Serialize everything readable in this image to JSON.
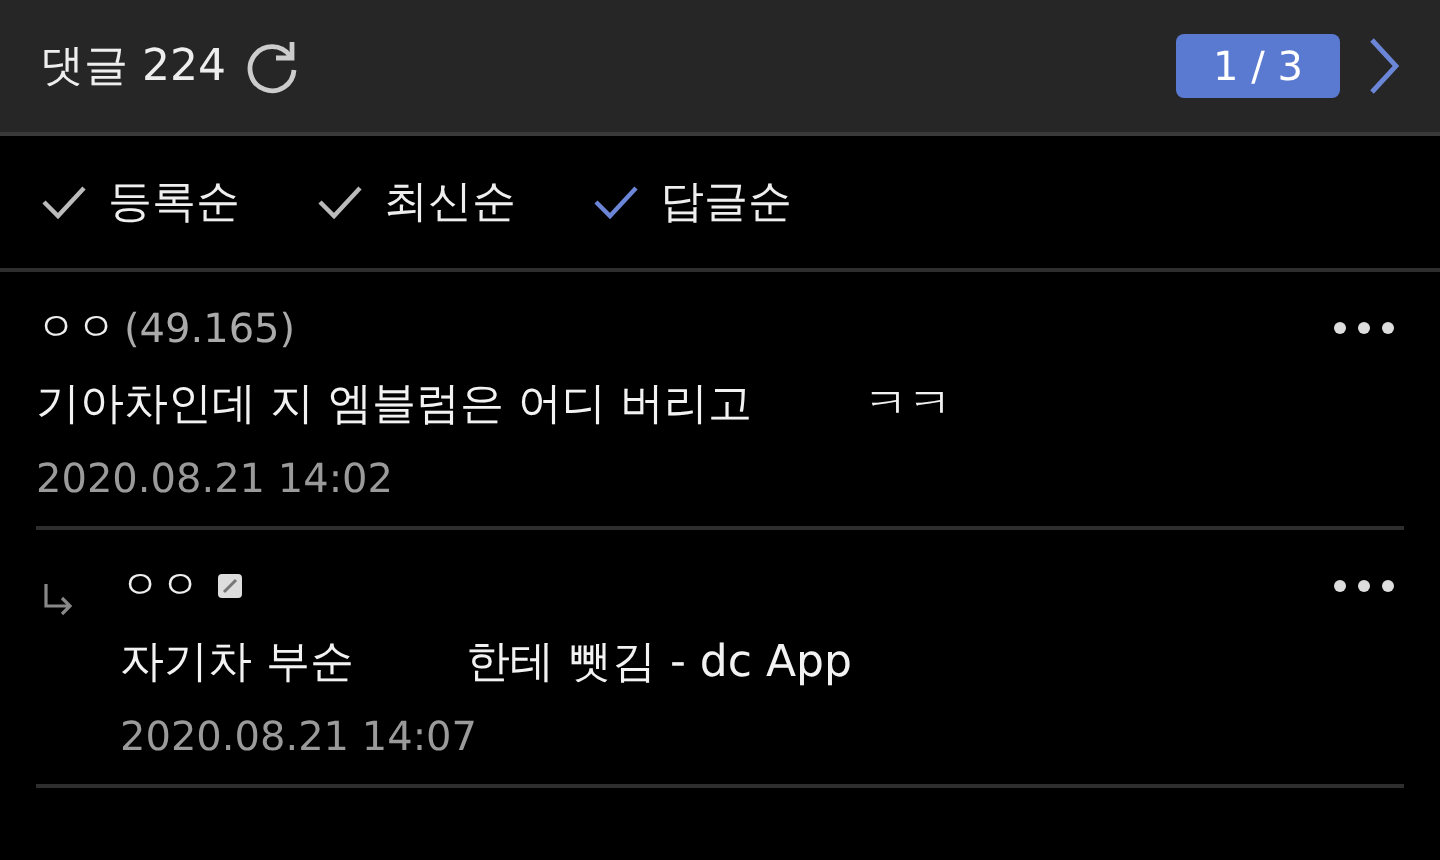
{
  "header": {
    "title": "댓글 224",
    "pager": "1 / 3"
  },
  "sort_options": [
    {
      "label": "등록순",
      "selected": false
    },
    {
      "label": "최신순",
      "selected": false
    },
    {
      "label": "답글순",
      "selected": true
    }
  ],
  "comments": [
    {
      "kind": "comment",
      "author": "ㅇㅇ",
      "ip": "(49.165)",
      "body": [
        "기아차인데 지 엠블럼은 어디 버리고",
        "ㅋㅋ"
      ],
      "date": "2020.08.21 14:02"
    },
    {
      "kind": "reply",
      "author": "ㅇㅇ",
      "body": [
        "자기차 부순",
        "한테 뺏김 - dc App"
      ],
      "date": "2020.08.21 14:07"
    }
  ]
}
